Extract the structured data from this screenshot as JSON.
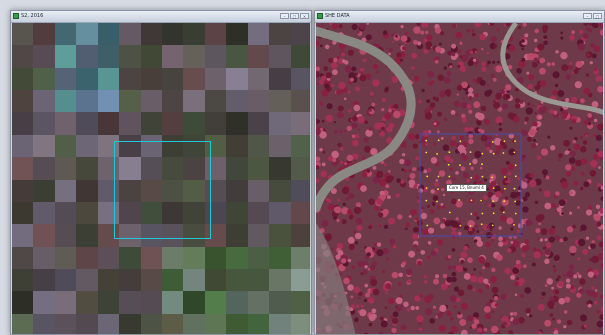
{
  "windows": {
    "left": {
      "title": "S2, 2016",
      "controls": [
        "–",
        "□",
        "×"
      ]
    },
    "right": {
      "title": "SHE DATA",
      "controls": [
        "–",
        "□"
      ],
      "plot_label": "Core 15, Bnuml 4"
    }
  },
  "colors": {
    "selection": "#1ec8d8",
    "plot_boundary": "#4a4ab0",
    "sample_points": "#ffe23a",
    "canopy": "#8a2040",
    "ground": "#7c7a74"
  }
}
